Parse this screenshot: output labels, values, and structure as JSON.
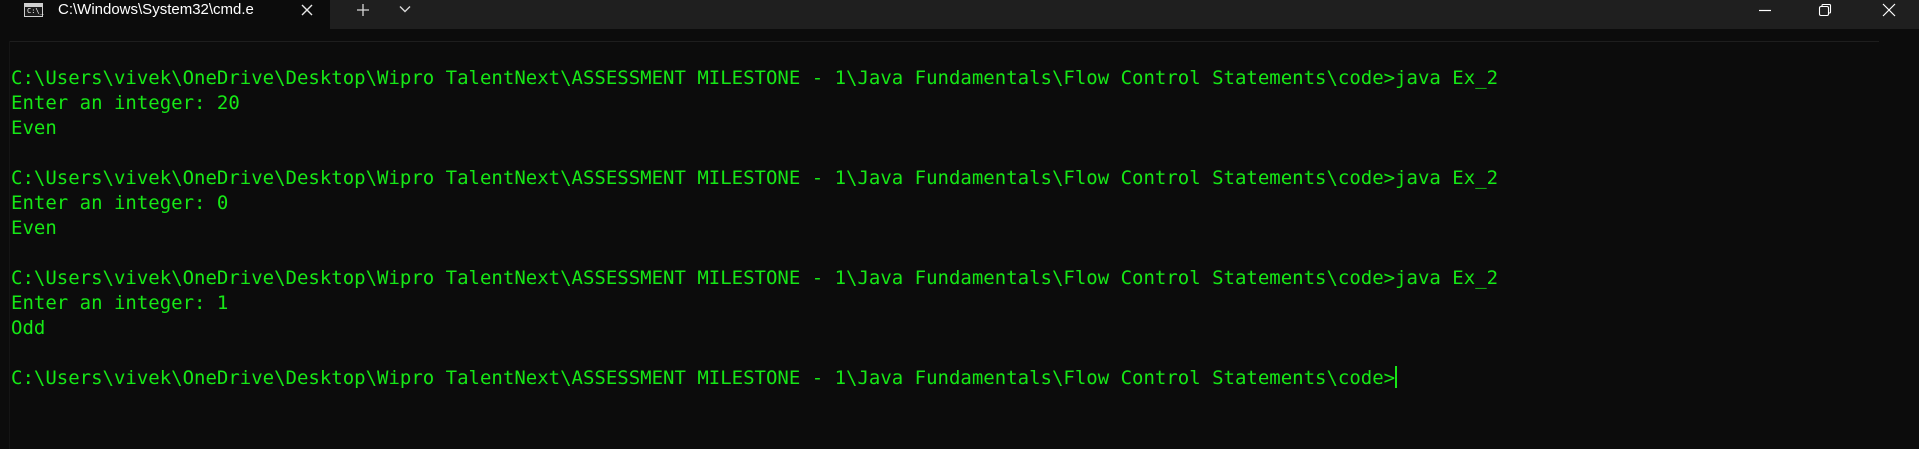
{
  "window": {
    "tab_title": "C:\\Windows\\System32\\cmd.e",
    "tab_icon_text": "C:\\_"
  },
  "colors": {
    "terminal_background": "#0c0c0c",
    "terminal_text": "#16e816",
    "titlebar_background": "#1f1f1f"
  },
  "icons": {
    "tab_icon": "cmd-icon",
    "close_tab": "close-icon",
    "new_tab": "plus-icon",
    "dropdown": "chevron-down-icon",
    "minimize": "minimize-icon",
    "maximize": "restore-icon",
    "close_window": "close-icon"
  },
  "terminal": {
    "lines": [
      "C:\\Users\\vivek\\OneDrive\\Desktop\\Wipro TalentNext\\ASSESSMENT MILESTONE - 1\\Java Fundamentals\\Flow Control Statements\\code>java Ex_2",
      "Enter an integer: 20",
      "Even",
      "",
      "C:\\Users\\vivek\\OneDrive\\Desktop\\Wipro TalentNext\\ASSESSMENT MILESTONE - 1\\Java Fundamentals\\Flow Control Statements\\code>java Ex_2",
      "Enter an integer: 0",
      "Even",
      "",
      "C:\\Users\\vivek\\OneDrive\\Desktop\\Wipro TalentNext\\ASSESSMENT MILESTONE - 1\\Java Fundamentals\\Flow Control Statements\\code>java Ex_2",
      "Enter an integer: 1",
      "Odd",
      "",
      "C:\\Users\\vivek\\OneDrive\\Desktop\\Wipro TalentNext\\ASSESSMENT MILESTONE - 1\\Java Fundamentals\\Flow Control Statements\\code>"
    ]
  }
}
